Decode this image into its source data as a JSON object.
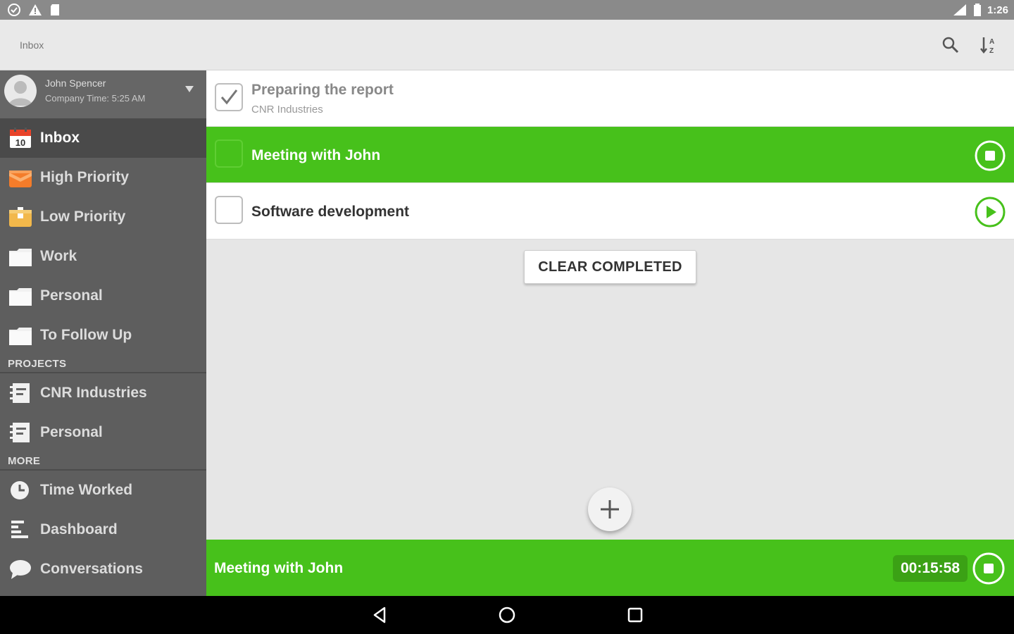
{
  "status_bar": {
    "time": "1:26"
  },
  "app_bar": {
    "title": "Inbox"
  },
  "profile": {
    "name": "John Spencer",
    "subtitle": "Company Time: 5:25 AM"
  },
  "sidebar": {
    "filters": [
      {
        "label": "Inbox",
        "icon": "calendar-icon",
        "badge": "10",
        "active": true
      },
      {
        "label": "High Priority",
        "icon": "high-priority-icon"
      },
      {
        "label": "Low Priority",
        "icon": "low-priority-icon"
      },
      {
        "label": "Work",
        "icon": "folder-icon"
      },
      {
        "label": "Personal",
        "icon": "folder-icon"
      },
      {
        "label": "To Follow Up",
        "icon": "folder-icon"
      }
    ],
    "projects_header": "PROJECTS",
    "projects": [
      {
        "label": "CNR Industries",
        "icon": "project-icon"
      },
      {
        "label": "Personal",
        "icon": "project-icon"
      }
    ],
    "more_header": "MORE",
    "more": [
      {
        "label": "Time Worked",
        "icon": "clock-icon"
      },
      {
        "label": "Dashboard",
        "icon": "dashboard-icon"
      },
      {
        "label": "Conversations",
        "icon": "chat-icon"
      }
    ]
  },
  "tasks": [
    {
      "title": "Preparing the report",
      "project": "CNR Industries",
      "state": "completed"
    },
    {
      "title": "Meeting with John",
      "state": "running",
      "action_icon": "stop-icon"
    },
    {
      "title": "Software development",
      "state": "idle",
      "action_icon": "play-icon"
    }
  ],
  "clear_completed_label": "CLEAR COMPLETED",
  "timer_bar": {
    "task": "Meeting with John",
    "elapsed": "00:15:58"
  },
  "colors": {
    "accent_green": "#47c11b",
    "sidebar_bg": "#5e5e5e",
    "status_bar": "#8a8a8a"
  }
}
